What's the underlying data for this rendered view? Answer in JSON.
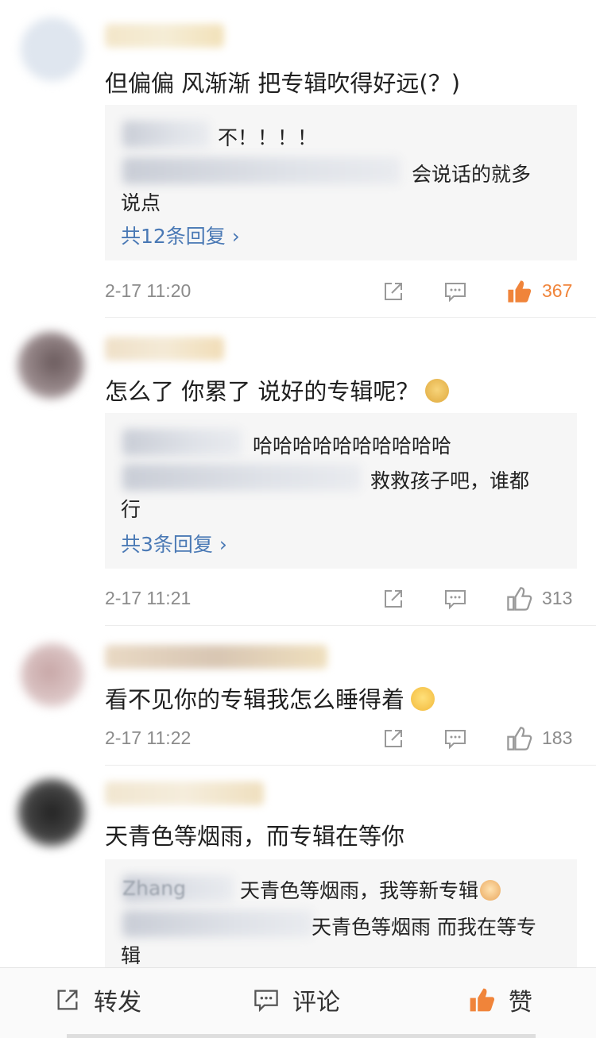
{
  "comments": [
    {
      "text": "但偏偏 风渐渐 把专辑吹得好远(？)",
      "replies": [
        "不！！！！",
        "会说话的就多",
        "说点"
      ],
      "more": "共12条回复 ›",
      "time": "2-17 11:20",
      "likes": "367",
      "liked": true
    },
    {
      "text": "怎么了 你累了 说好的专辑呢？",
      "replies": [
        "哈哈哈哈哈哈哈哈哈哈",
        "救救孩子吧，谁都",
        "行"
      ],
      "more": "共3条回复 ›",
      "time": "2-17 11:21",
      "likes": "313",
      "liked": false
    },
    {
      "text": "看不见你的专辑我怎么睡得着",
      "time": "2-17 11:22",
      "likes": "183",
      "liked": false
    },
    {
      "text": "天青色等烟雨，而专辑在等你",
      "reply_user_fragment": "Zhang",
      "replies": [
        "天青色等烟雨，我等新专辑",
        "天青色等烟雨 而我在等专",
        "辑"
      ]
    }
  ],
  "toolbar": {
    "repost": "转发",
    "comment": "评论",
    "like": "赞"
  },
  "colors": {
    "like_active": "#f0843a",
    "link": "#4a79b5",
    "meta": "#8b8b8b"
  }
}
